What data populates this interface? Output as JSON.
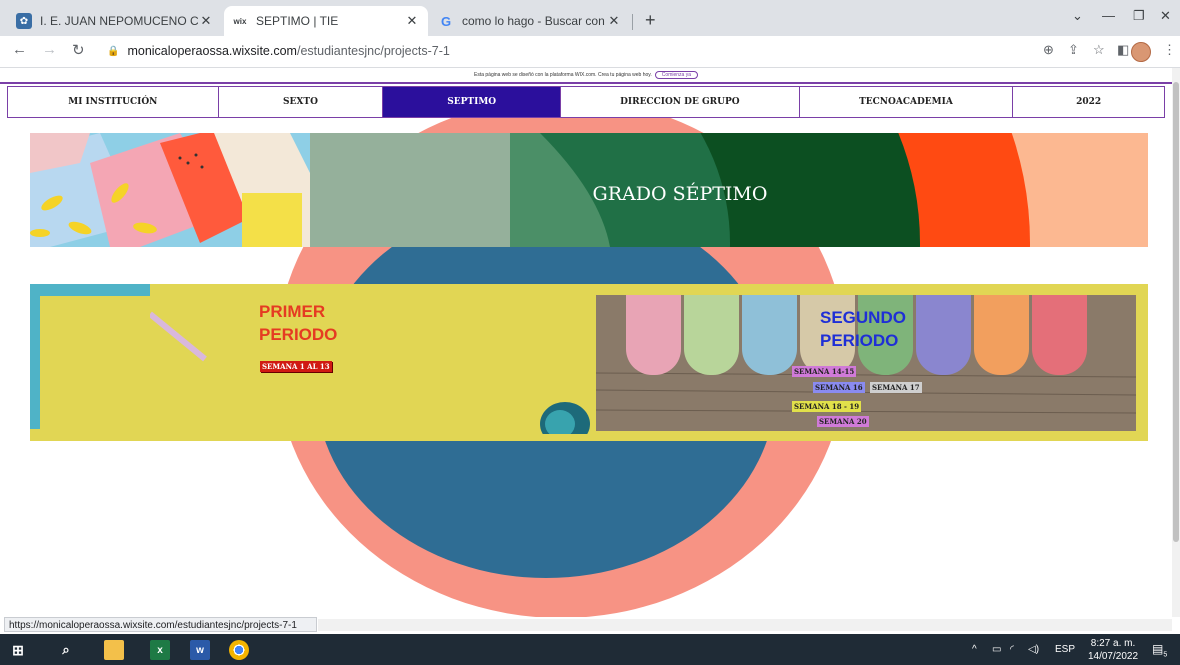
{
  "browser": {
    "tabs": [
      {
        "title": "I. E. JUAN NEPOMUCENO CADA",
        "favicon": "wix-site-icon"
      },
      {
        "title": "SEPTIMO | TIE",
        "favicon": "wix-icon",
        "favicon_text": "wix"
      },
      {
        "title": "como lo hago - Buscar con Goog",
        "favicon": "google-icon",
        "favicon_text": "G"
      }
    ],
    "url_domain": "monicaloperaossa.wixsite.com",
    "url_path": "/estudiantesjnc/projects-7-1"
  },
  "page": {
    "wix_banner": "Esta página web se diseñó con la plataforma WIX.com. Crea tu página web hoy.",
    "wix_banner_button": "Comienza ya",
    "menu": [
      "MI INSTITUCIÓN",
      "SEXTO",
      "SEPTIMO",
      "DIRECCION DE GRUPO",
      "TECNOACADEMIA",
      "2022"
    ],
    "menu_selected": "SEPTIMO",
    "hero_title": "GRADO SÉPTIMO",
    "primer": {
      "line1": "PRIMER",
      "line2": "PERIODO",
      "tag": "SEMANA 1 AL 13"
    },
    "segundo": {
      "line1": "SEGUNDO",
      "line2": "PERIODO",
      "tags": [
        "SEMANA 14-15",
        "SEMANA 16",
        "SEMANA 17",
        "SEMANA 18 - 19",
        "SEMANA 20"
      ]
    }
  },
  "status_url": "https://monicaloperaossa.wixsite.com/estudiantesjnc/projects-7-1",
  "taskbar": {
    "language": "ESP",
    "time": "8:27 a. m.",
    "date": "14/07/2022",
    "notifications": "5"
  },
  "colors": {
    "menu_selected": "#2b0f9c",
    "accent_purple": "#7a3fa7",
    "primer_red": "#e53b22",
    "segundo_blue": "#1f2fd6"
  }
}
